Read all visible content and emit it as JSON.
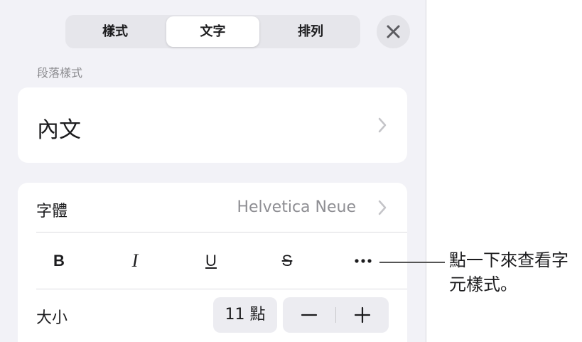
{
  "tabs": [
    {
      "label": "樣式",
      "selected": false
    },
    {
      "label": "文字",
      "selected": true
    },
    {
      "label": "排列",
      "selected": false
    }
  ],
  "close_icon": "close-icon",
  "paragraph_style": {
    "section_label": "段落樣式",
    "value": "內文"
  },
  "font": {
    "label": "字體",
    "value": "Helvetica Neue"
  },
  "formatting": {
    "bold": "B",
    "italic": "I",
    "underline": "U",
    "strikethrough": "S",
    "more_icon": "ellipsis-icon"
  },
  "size": {
    "label": "大小",
    "value": "11 點",
    "decrease_icon": "minus-icon",
    "increase_icon": "plus-icon"
  },
  "callout": {
    "text": "點一下來查看字元樣式。"
  },
  "colors": {
    "panel_bg": "#f2f2f7",
    "card_bg": "#ffffff",
    "secondary_text": "#8e8e93"
  }
}
